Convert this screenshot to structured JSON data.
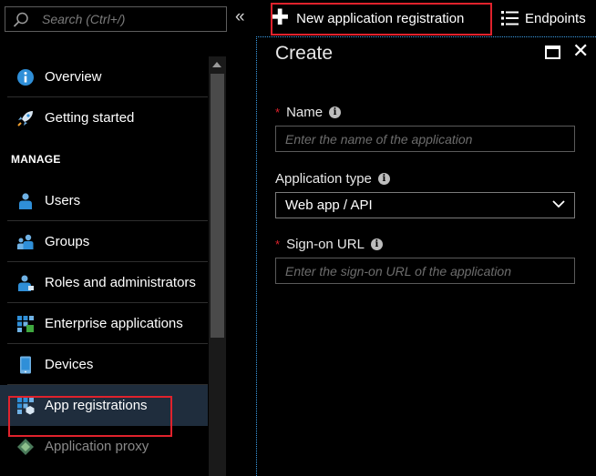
{
  "search": {
    "placeholder": "Search (Ctrl+/)"
  },
  "collapse_glyph": "«",
  "nav": {
    "top_items": [
      {
        "label": "Overview",
        "icon": "info-icon"
      },
      {
        "label": "Getting started",
        "icon": "rocket-icon"
      }
    ],
    "section_header": "MANAGE",
    "manage_items": [
      {
        "label": "Users",
        "icon": "user-icon"
      },
      {
        "label": "Groups",
        "icon": "group-icon"
      },
      {
        "label": "Roles and administrators",
        "icon": "roles-icon"
      },
      {
        "label": "Enterprise applications",
        "icon": "enterprise-apps-icon"
      },
      {
        "label": "Devices",
        "icon": "device-icon"
      },
      {
        "label": "App registrations",
        "icon": "app-registrations-icon",
        "active": true
      },
      {
        "label": "Application proxy",
        "icon": "app-proxy-icon"
      }
    ]
  },
  "toolbar": {
    "new_app_label": "New application registration",
    "endpoints_label": "Endpoints"
  },
  "blade": {
    "title": "Create",
    "name_label": "Name",
    "name_placeholder": "Enter the name of the application",
    "app_type_label": "Application type",
    "app_type_value": "Web app / API",
    "signon_label": "Sign-on URL",
    "signon_placeholder": "Enter the sign-on URL of the application",
    "required_mark": "*"
  },
  "colors": {
    "highlight": "#e0222c",
    "accent_blue": "#3a9ee8",
    "active_bg": "#1f2d3d"
  }
}
